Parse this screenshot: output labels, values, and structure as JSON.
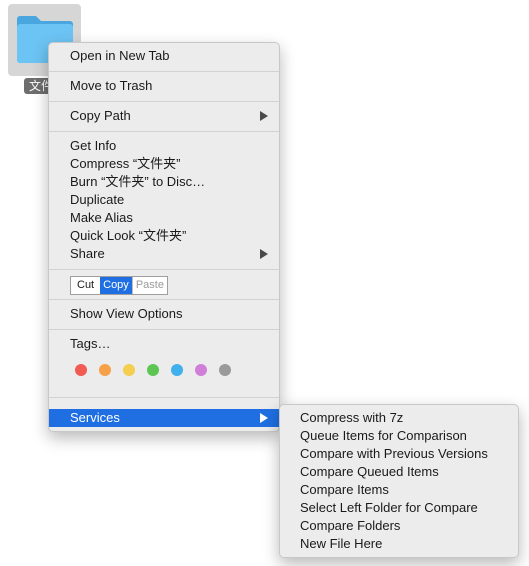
{
  "desktop": {
    "folder_name": "文件夹",
    "folder_color": "#5bb8ef"
  },
  "context_menu": {
    "open_new_tab": "Open in New Tab",
    "move_to_trash": "Move to Trash",
    "copy_path": "Copy Path",
    "get_info": "Get Info",
    "compress": "Compress “文件夹”",
    "burn": "Burn “文件夹” to Disc…",
    "duplicate": "Duplicate",
    "make_alias": "Make Alias",
    "quick_look": "Quick Look “文件夹”",
    "share": "Share",
    "edit_control": {
      "cut": "Cut",
      "copy": "Copy",
      "paste": "Paste",
      "selected": "Copy"
    },
    "show_view_options": "Show View Options",
    "tags_label": "Tags…",
    "tag_colors": [
      {
        "name": "red",
        "color": "#f25b52"
      },
      {
        "name": "orange",
        "color": "#f6a14a"
      },
      {
        "name": "yellow",
        "color": "#f5cd4f"
      },
      {
        "name": "green",
        "color": "#5dc653"
      },
      {
        "name": "blue",
        "color": "#3fb0ec"
      },
      {
        "name": "purple",
        "color": "#cf7fd8"
      },
      {
        "name": "gray",
        "color": "#9a9a9a"
      }
    ],
    "services": "Services",
    "highlight_color": "#1f6fe2"
  },
  "services_menu": {
    "items": [
      "Compress with 7z",
      "Queue Items for Comparison",
      "Compare with Previous Versions",
      "Compare Queued Items",
      "Compare Items",
      "Select Left Folder for Compare",
      "Compare Folders",
      "New File Here"
    ]
  }
}
